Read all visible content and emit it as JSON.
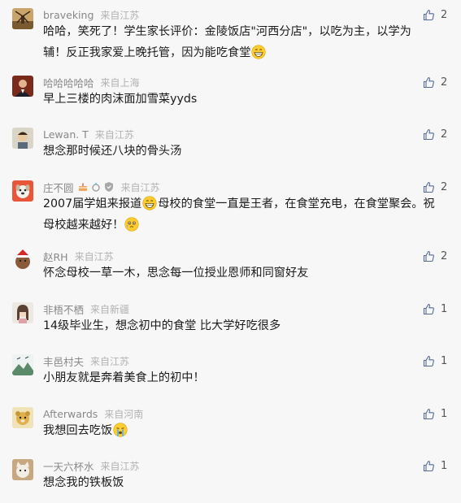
{
  "comments": [
    {
      "name": "braveking",
      "location": "来自江苏",
      "likes": "2",
      "avatar_icon": "windmill-avatar",
      "lines": [
        [
          "哈哈，笑死了！学生家长评价：金陵饭店\"河西分店\"，以吃为主，以学为"
        ],
        [
          "辅！反正我家爱上晚托管，因为能吃食堂",
          "grin-emoji"
        ]
      ]
    },
    {
      "name": "哈哈哈哈哈",
      "location": "来自上海",
      "likes": "2",
      "avatar_icon": "man-portrait-avatar",
      "lines": [
        [
          "早上三楼的肉沫面加雪菜yyds"
        ]
      ]
    },
    {
      "name": "Lewan. T",
      "location": "来自江苏",
      "likes": "2",
      "avatar_icon": "boy-avatar",
      "lines": [
        [
          "想念那时候还八块的骨头汤"
        ]
      ]
    },
    {
      "name": "庄不圆",
      "location": "来自江苏",
      "likes": "2",
      "avatar_icon": "dog-avatar",
      "badges": [
        "cake-badge",
        "ring-badge",
        "shield-badge"
      ],
      "lines": [
        [
          "2007届学姐来报道",
          "grin-emoji",
          "母校的食堂一直是王者，在食堂充电，在食堂聚会。祝"
        ],
        [
          "母校越来越好！",
          "tear-emoji"
        ]
      ]
    },
    {
      "name": "赵RH",
      "location": "来自江苏",
      "likes": "2",
      "avatar_icon": "santa-hat-avatar",
      "lines": [
        [
          "怀念母校一草一木，思念每一位授业恩师和同窗好友"
        ]
      ]
    },
    {
      "name": "非梧不栖",
      "location": "来自新疆",
      "likes": "1",
      "avatar_icon": "girl-avatar",
      "lines": [
        [
          "14级毕业生，想念初中的食堂 比大学好吃很多"
        ]
      ]
    },
    {
      "name": "丰邑村夫",
      "location": "来自江苏",
      "likes": "1",
      "avatar_icon": "landscape-avatar",
      "lines": [
        [
          "小朋友就是奔着美食上的初中！"
        ]
      ]
    },
    {
      "name": "Afterwards",
      "location": "来自河南",
      "likes": "1",
      "avatar_icon": "bear-avatar",
      "lines": [
        [
          "我想回去吃饭",
          "cry-emoji"
        ]
      ]
    },
    {
      "name": "一天六杯水",
      "location": "来自江苏",
      "likes": "1",
      "avatar_icon": "cat-avatar",
      "lines": [
        [
          "想念我的铁板饭"
        ]
      ]
    }
  ]
}
